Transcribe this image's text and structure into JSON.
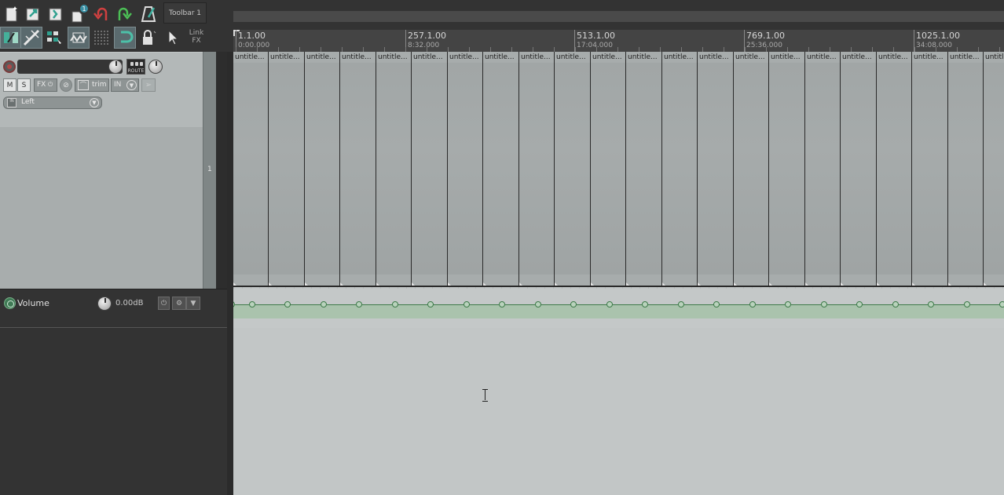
{
  "toolbar": {
    "label": "Toolbar 1",
    "link_fx": "Link\nFX",
    "buttons": [
      {
        "name": "new-project-icon"
      },
      {
        "name": "open-project-icon"
      },
      {
        "name": "save-project-icon"
      },
      {
        "name": "project-settings-icon",
        "badge": "1"
      },
      {
        "name": "undo-icon"
      },
      {
        "name": "redo-icon"
      },
      {
        "name": "metronome-icon"
      },
      {
        "name": "auto-crossfade-icon"
      },
      {
        "name": "ripple-edit-icon"
      },
      {
        "name": "grouping-icon"
      },
      {
        "name": "snap-icon"
      },
      {
        "name": "grid-icon"
      },
      {
        "name": "loop-icon"
      },
      {
        "name": "lock-icon"
      },
      {
        "name": "cursor-icon"
      }
    ]
  },
  "ruler": {
    "markers": [
      {
        "bar": "1.1.00",
        "time": "0:00.000"
      },
      {
        "bar": "257.1.00",
        "time": "8:32.000"
      },
      {
        "bar": "513.1.00",
        "time": "17:04.000"
      },
      {
        "bar": "769.1.00",
        "time": "25:36.000"
      },
      {
        "bar": "1025.1.00",
        "time": "34:08.000"
      }
    ]
  },
  "track": {
    "number": "1",
    "mute_label": "M",
    "solo_label": "S",
    "fx_label": "FX",
    "env_label": "trim",
    "in_label": "IN",
    "route_label": "ROUTE",
    "input": "Left"
  },
  "envelope": {
    "name": "Volume",
    "value": "0.00dB"
  },
  "items": {
    "label": "untitle..."
  }
}
